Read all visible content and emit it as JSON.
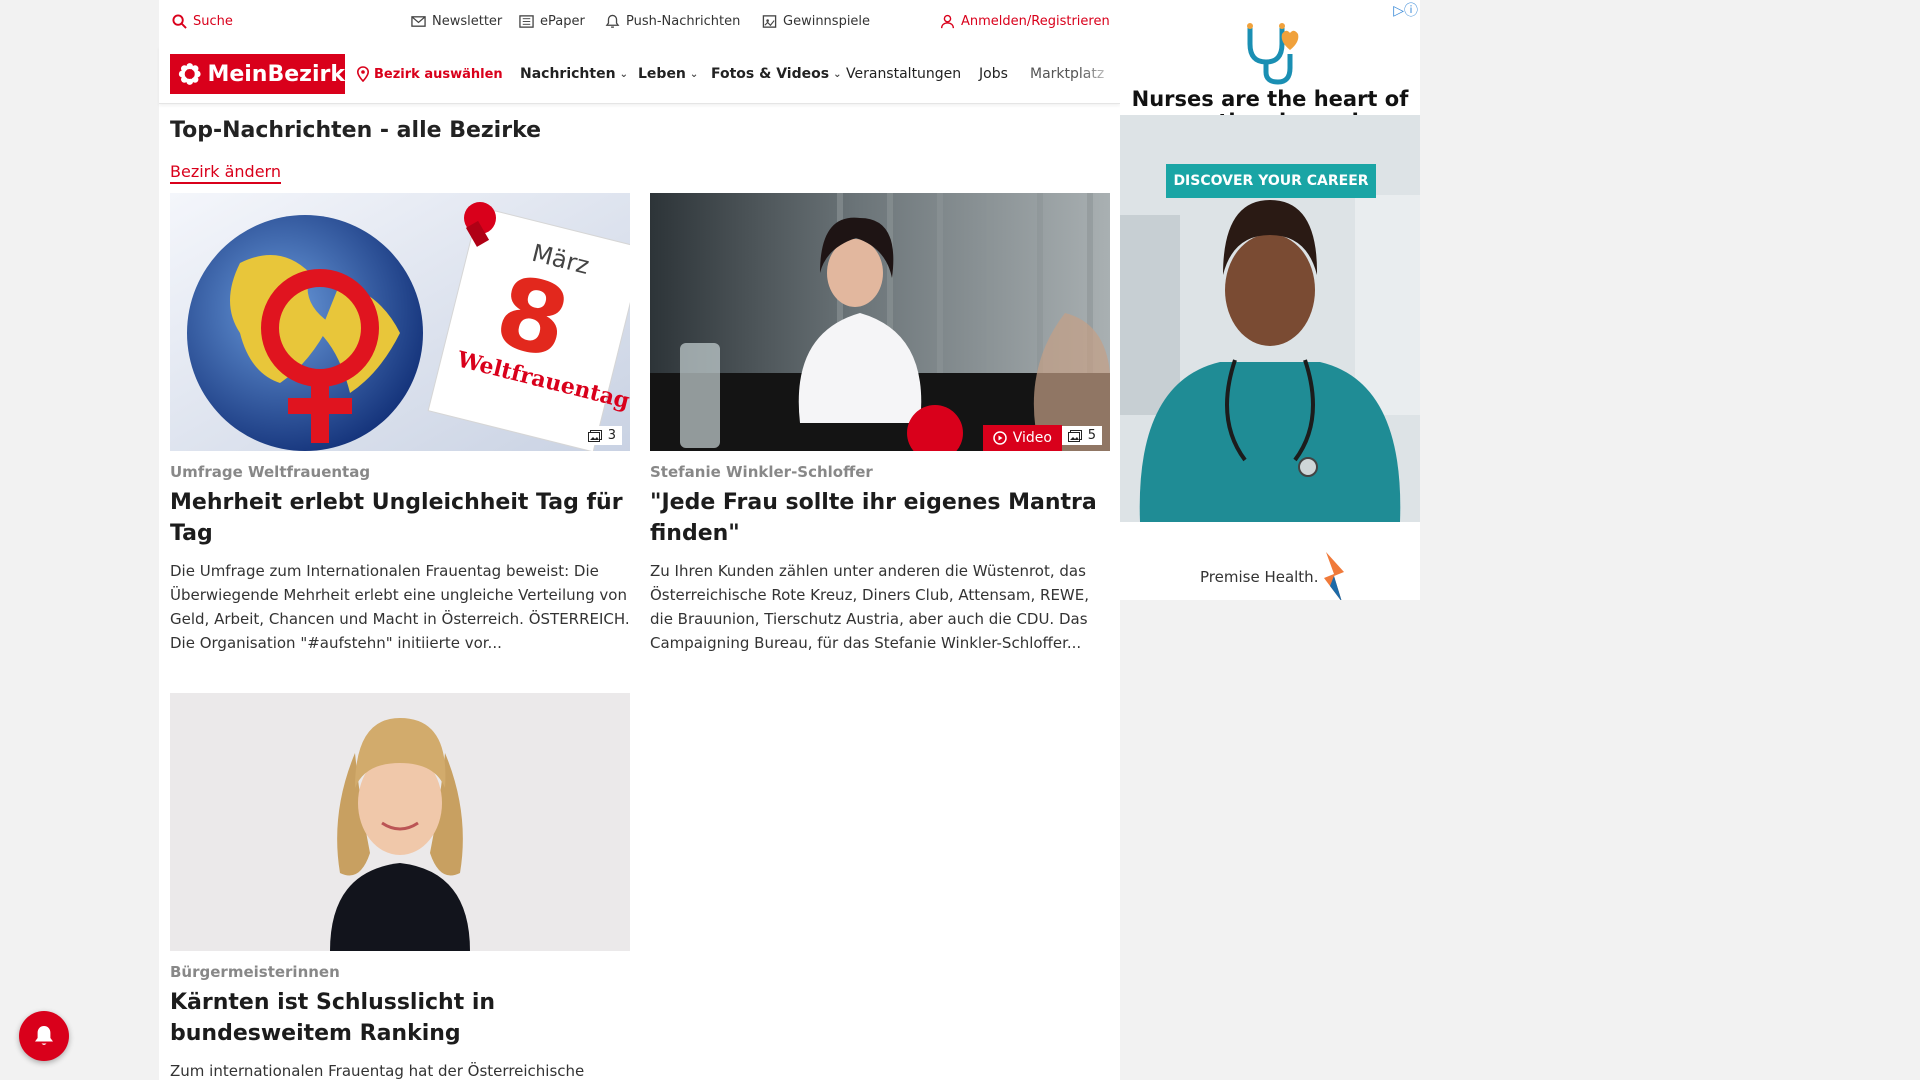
{
  "utilbar": {
    "search_label": "Suche",
    "newsletter_label": "Newsletter",
    "epaper_label": "ePaper",
    "push_label": "Push-Nachrichten",
    "gewinnspiele_label": "Gewinnspiele",
    "login_label": "Anmelden/Registrieren"
  },
  "nav": {
    "logo_text": "MeinBezirk",
    "district_label": "Bezirk auswählen",
    "items": [
      {
        "label": "Nachrichten"
      },
      {
        "label": "Leben"
      },
      {
        "label": "Fotos & Videos"
      },
      {
        "label": "Veranstaltungen"
      },
      {
        "label": "Jobs"
      },
      {
        "label": "Marktplatz"
      }
    ]
  },
  "main": {
    "section_title": "Top-Nachrichten - alle Bezirke",
    "change_district": "Bezirk ändern",
    "articles": [
      {
        "kicker": "Umfrage Weltfrauentag",
        "title": "Mehrheit erlebt Ungleichheit Tag für Tag",
        "teaser": "Die Umfrage zum Internationalen Frauentag beweist: Die Überwiegende Mehrheit erlebt eine ungleiche Verteilung von Geld, Arbeit, Chancen und Macht in Österreich. ÖSTERREICH. Die Organisation \"#aufstehn\" initiierte vor...",
        "image_count": "3",
        "img_month": "März",
        "img_day": "8",
        "img_caption": "Weltfrauentag"
      },
      {
        "kicker": "Stefanie Winkler-Schloffer",
        "title": "\"Jede Frau sollte ihr eigenes Mantra finden\"",
        "teaser": "Zu Ihren Kunden zählen unter anderen die Wüstenrot, das Österreichische Rote Kreuz, Diners Club, Attensam, REWE, die Brauunion, Tierschutz Austria, aber auch die CDU. Das Campaigning Bureau, für das Stefanie Winkler-Schloffer...",
        "video_label": "Video",
        "image_count": "5"
      },
      {
        "kicker": "Bürgermeisterinnen",
        "title": "Kärnten ist Schlusslicht in bundesweitem Ranking",
        "teaser": "Zum internationalen Frauentag hat der Österreichische"
      }
    ]
  },
  "ad": {
    "headline": "Nurses are the heart of exceptional member care.",
    "cta": "DISCOVER YOUR CAREER",
    "brand": "Premise Health."
  },
  "colors": {
    "brand_red": "#d9001b",
    "ad_teal": "#1aa5a5"
  }
}
